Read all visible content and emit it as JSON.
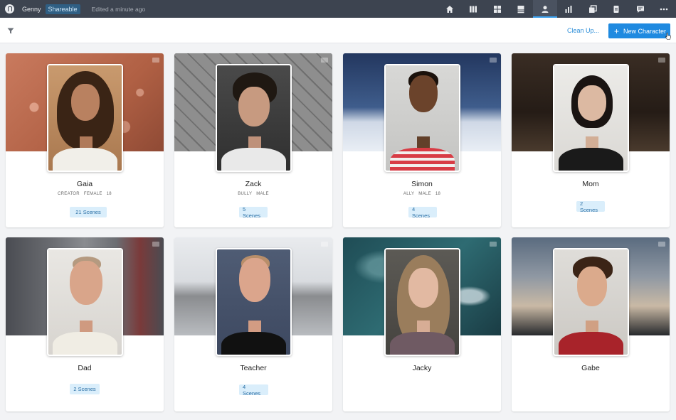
{
  "topbar": {
    "app_name": "Genny",
    "share_badge": "Shareable",
    "edited_text": "Edited a minute ago",
    "nav": [
      {
        "icon": "home-icon"
      },
      {
        "icon": "columns-icon"
      },
      {
        "icon": "grid-icon"
      },
      {
        "icon": "layout-icon"
      },
      {
        "icon": "person-icon",
        "active": true
      },
      {
        "icon": "bar-chart-icon"
      },
      {
        "icon": "copy-icon"
      },
      {
        "icon": "document-icon"
      },
      {
        "icon": "chat-icon"
      },
      {
        "icon": "more-icon"
      }
    ]
  },
  "toolbar": {
    "cleanup_label": "Clean Up...",
    "new_character_label": "New Character",
    "new_character_plus": "+"
  },
  "characters": [
    {
      "name": "Gaia",
      "tags": [
        "CREATOR",
        "FEMALE",
        "18"
      ],
      "scenes": "21 Scenes"
    },
    {
      "name": "Zack",
      "tags": [
        "BULLY",
        "MALE"
      ],
      "scenes": "5 Scenes"
    },
    {
      "name": "Simon",
      "tags": [
        "ALLY",
        "MALE",
        "18"
      ],
      "scenes": "4 Scenes"
    },
    {
      "name": "Mom",
      "tags": [],
      "scenes": "2 Scenes"
    },
    {
      "name": "Dad",
      "tags": [],
      "scenes": "2 Scenes"
    },
    {
      "name": "Teacher",
      "tags": [],
      "scenes": "4 Scenes"
    },
    {
      "name": "Jacky",
      "tags": [],
      "scenes": ""
    },
    {
      "name": "Gabe",
      "tags": [],
      "scenes": ""
    }
  ],
  "colors": {
    "topbar_bg": "#3d4450",
    "accent": "#1f8ae0",
    "scene_badge_bg": "#daeefb"
  }
}
